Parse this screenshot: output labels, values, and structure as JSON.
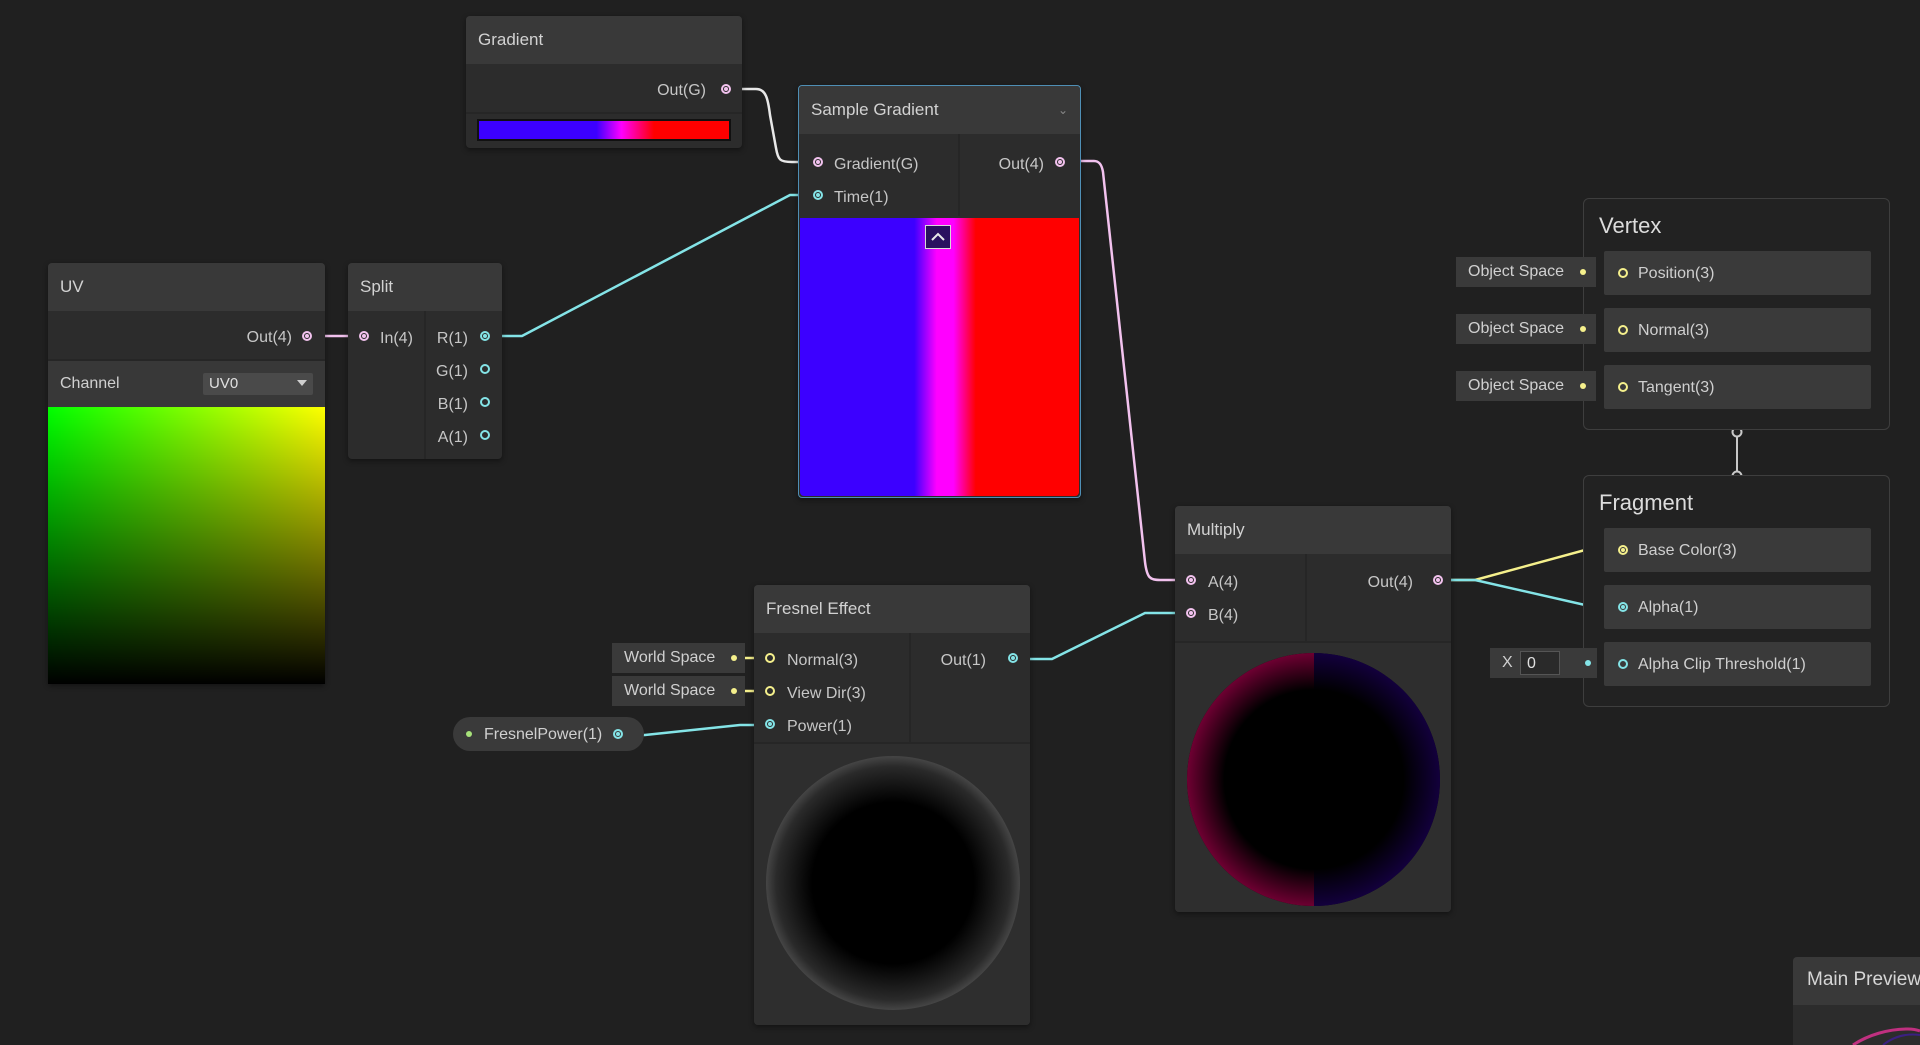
{
  "colors": {
    "background": "#202020",
    "wire_cyan": "#84e4e7",
    "wire_pink": "#f2c2ee",
    "wire_yellow": "#f5f08c",
    "gradient_blue": "#3c00ff",
    "gradient_magenta": "#ff00ff",
    "gradient_red": "#ff0000"
  },
  "nodes": {
    "gradient": {
      "title": "Gradient",
      "output": "Out(G)"
    },
    "sample_gradient": {
      "title": "Sample Gradient",
      "inputs": [
        "Gradient(G)",
        "Time(1)"
      ],
      "output": "Out(4)",
      "collapse_icon": "chevron-up-icon"
    },
    "uv": {
      "title": "UV",
      "output": "Out(4)",
      "channel_label": "Channel",
      "channel_value": "UV0"
    },
    "split": {
      "title": "Split",
      "input": "In(4)",
      "outputs": [
        "R(1)",
        "G(1)",
        "B(1)",
        "A(1)"
      ]
    },
    "fresnel": {
      "title": "Fresnel Effect",
      "inputs": [
        "Normal(3)",
        "View Dir(3)",
        "Power(1)"
      ],
      "output": "Out(1)",
      "normal_space": "World Space",
      "view_space": "World Space"
    },
    "fresnel_power": {
      "label": "FresnelPower(1)"
    },
    "multiply": {
      "title": "Multiply",
      "inputs": [
        "A(4)",
        "B(4)"
      ],
      "output": "Out(4)"
    },
    "vertex": {
      "title": "Vertex",
      "ports": [
        "Position(3)",
        "Normal(3)",
        "Tangent(3)"
      ],
      "spaces": [
        "Object Space",
        "Object Space",
        "Object Space"
      ]
    },
    "fragment": {
      "title": "Fragment",
      "ports": [
        "Base Color(3)",
        "Alpha(1)",
        "Alpha Clip Threshold(1)"
      ],
      "alpha_clip_axis": "X",
      "alpha_clip_value": "0"
    },
    "main_preview": {
      "title": "Main Preview"
    }
  }
}
